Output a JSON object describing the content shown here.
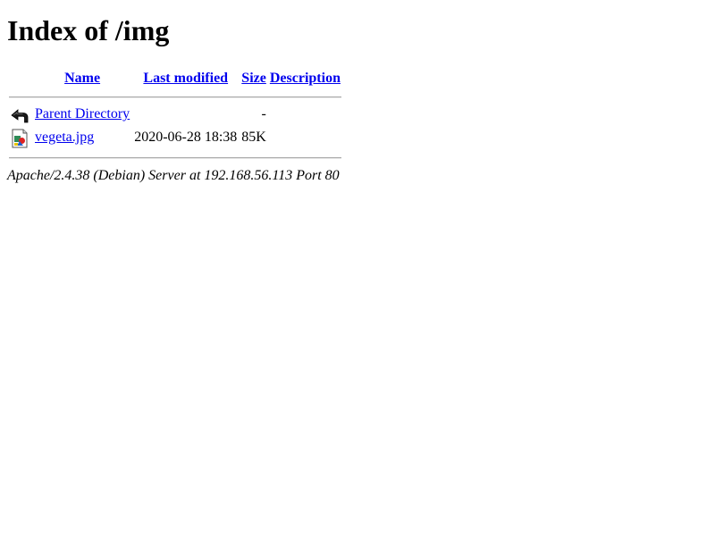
{
  "page": {
    "title": "Index of /img"
  },
  "table": {
    "headers": {
      "name": "Name",
      "last_modified": "Last modified",
      "size": "Size",
      "description": "Description"
    },
    "rows": [
      {
        "icon": "back-arrow-icon",
        "name": "Parent Directory",
        "last_modified": "",
        "size": "-",
        "description": ""
      },
      {
        "icon": "image-file-icon",
        "name": "vegeta.jpg",
        "last_modified": "2020-06-28 18:38",
        "size": "85K",
        "description": ""
      }
    ]
  },
  "footer": {
    "server_signature": "Apache/2.4.38 (Debian) Server at 192.168.56.113 Port 80"
  },
  "colors": {
    "link": "#0000ee",
    "rule": "#a9a9a9"
  }
}
